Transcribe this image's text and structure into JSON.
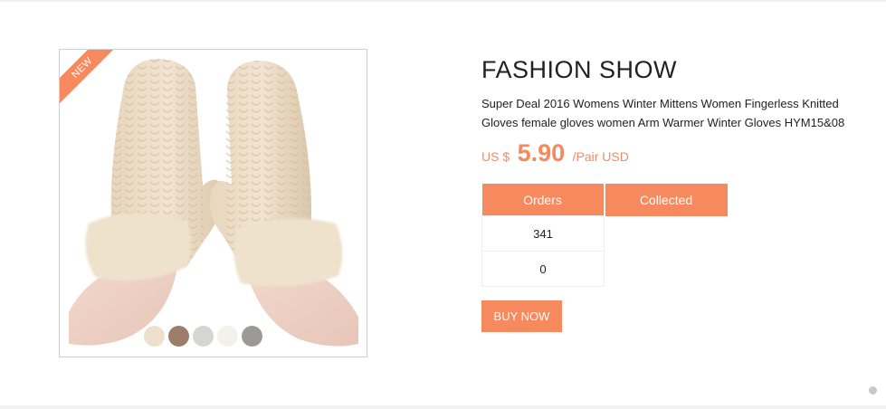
{
  "badge": {
    "label": "NEW"
  },
  "swatches": [
    "#ede1cd",
    "#9d7c6c",
    "#d6d6d1",
    "#f3f1e9",
    "#9b9a97"
  ],
  "product": {
    "brand": "FASHION SHOW",
    "description": "Super Deal 2016 Womens Winter Mittens Women Fingerless Knitted Gloves female gloves women Arm Warmer Winter Gloves HYM15&08",
    "price_prefix": "US $",
    "price": "5.90",
    "price_suffix": "/Pair USD"
  },
  "stats": {
    "headers": [
      "Orders",
      "Collected"
    ],
    "values": [
      "341",
      "0"
    ]
  },
  "buy_button": "BUY NOW",
  "colors": {
    "accent": "#f7895f",
    "mitten": "#ead9c2"
  }
}
